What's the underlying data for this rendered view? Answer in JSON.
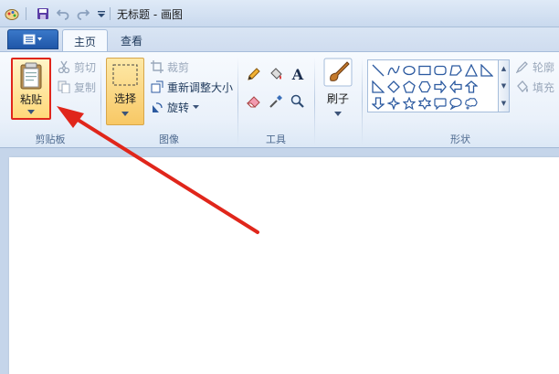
{
  "window": {
    "title": "无标题 - 画图"
  },
  "tabs": [
    {
      "label": "主页"
    },
    {
      "label": "查看"
    }
  ],
  "clipboard": {
    "group_label": "剪贴板",
    "paste": "粘贴",
    "cut": "剪切",
    "copy": "复制"
  },
  "image": {
    "group_label": "图像",
    "select": "选择",
    "crop": "裁剪",
    "resize": "重新调整大小",
    "rotate": "旋转"
  },
  "tools": {
    "group_label": "工具",
    "text_glyph": "A"
  },
  "brush": {
    "label": "刷子"
  },
  "shapes": {
    "group_label": "形状",
    "outline": "轮廓",
    "fill": "填充"
  },
  "colors": {
    "accent": "#1f56a8",
    "highlight": "#e0261b",
    "selected": "#f8c865"
  }
}
